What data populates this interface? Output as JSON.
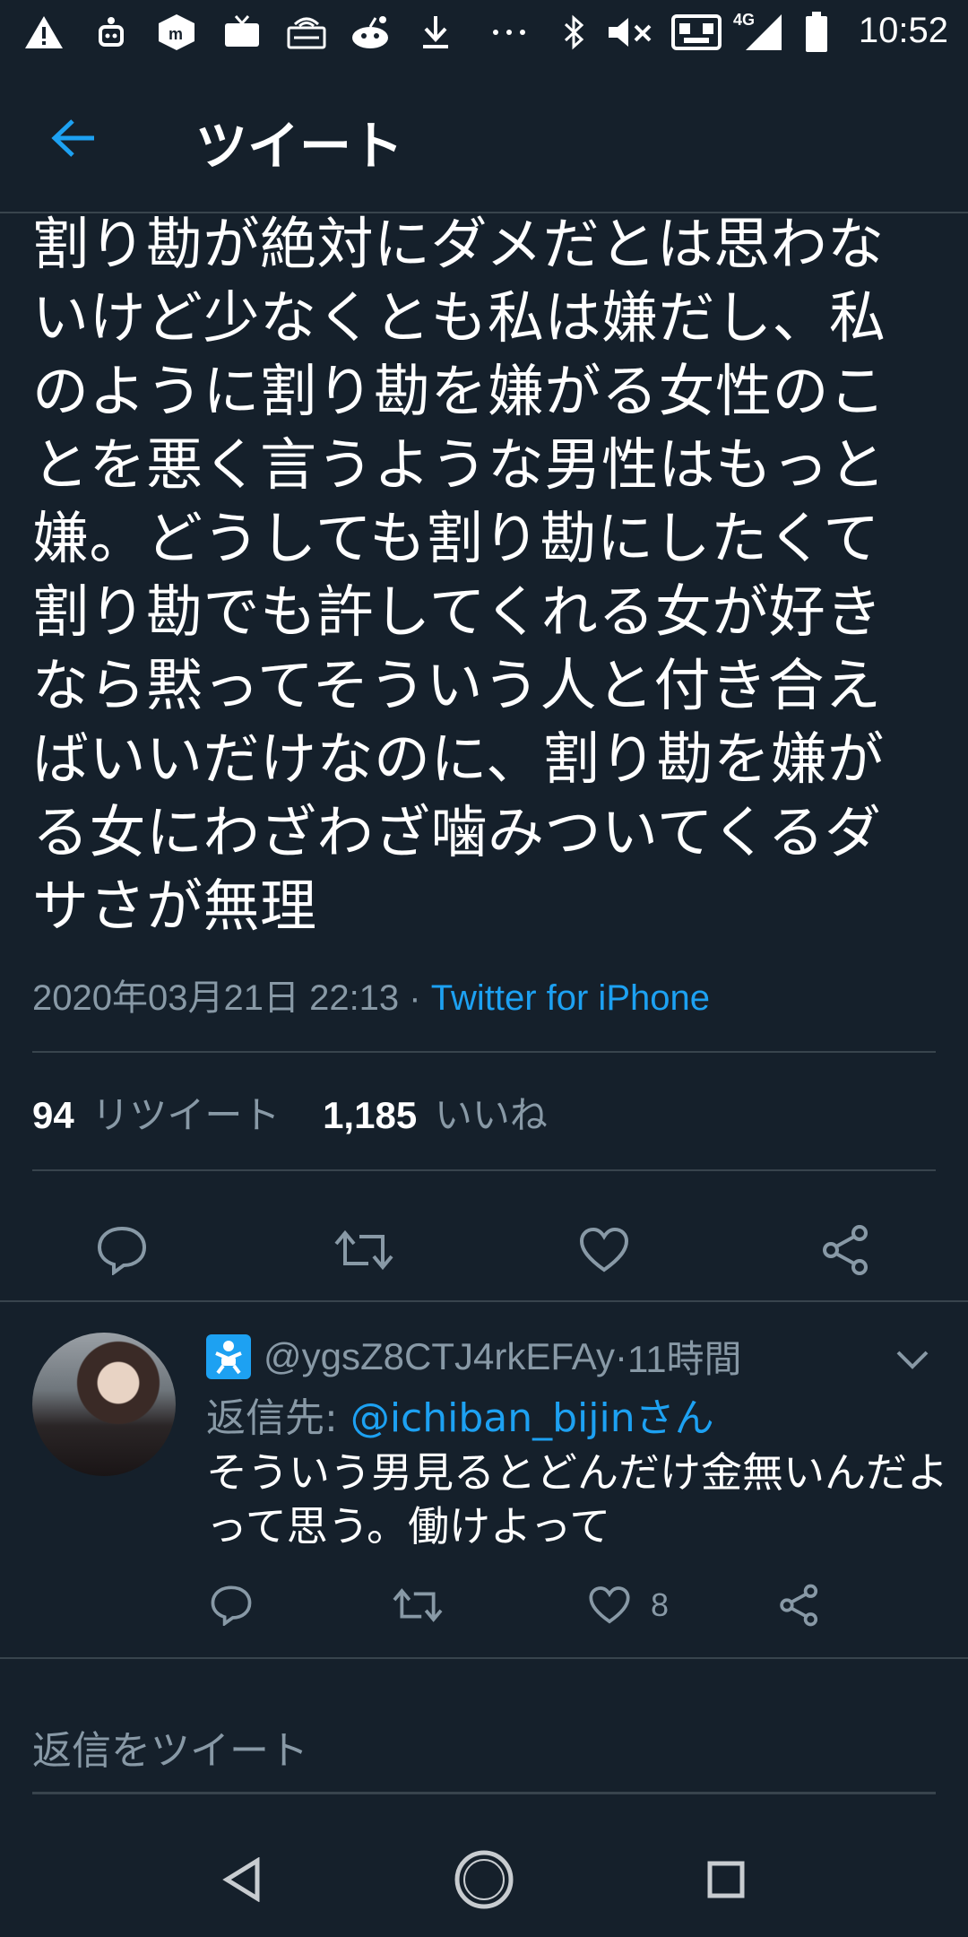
{
  "status_bar": {
    "time": "10:52",
    "network": "4G",
    "icons": [
      "warning-icon",
      "android-robot-icon",
      "mercari-icon",
      "tv-icon",
      "router-icon",
      "reddit-icon",
      "download-icon",
      "more-dots-icon",
      "bluetooth-icon",
      "mute-icon",
      "gamepad-icon",
      "signal-icon",
      "battery-icon"
    ]
  },
  "header": {
    "title": "ツイート"
  },
  "tweet": {
    "text": "割り勘が絶対にダメだとは思わな\nいけど少なくとも私は嫌だし、私\nのように割り勘を嫌がる女性のこ\nとを悪く言うような男性はもっと\n嫌。どうしても割り勘にしたくて\n割り勘でも許してくれる女が好き\nなら黙ってそういう人と付き合え\nばいいだけなのに、割り勘を嫌が\nる女にわざわざ噛みついてくるダ\nサさが無理",
    "datetime": "2020年03月21日 22:13",
    "separator": " · ",
    "source": "Twitter for iPhone",
    "retweets_count": "94",
    "retweets_label": "リツイート",
    "likes_count": "1,185",
    "likes_label": "いいね"
  },
  "reply": {
    "handle": "@ygsZ8CTJ4rkEFAy",
    "separator": " · ",
    "time_ago": "11時間",
    "reply_to_prefix": "返信先: ",
    "reply_to_user": "@ichiban_bijinさん",
    "text": "そういう男見るとどんだけ金無いんだよ\nって思う。働けよって",
    "like_count": "8"
  },
  "compose": {
    "placeholder": "返信をツイート"
  },
  "colors": {
    "background": "#15202b",
    "accent": "#1da1f2",
    "muted": "#8899a6",
    "divider": "#38444d"
  }
}
